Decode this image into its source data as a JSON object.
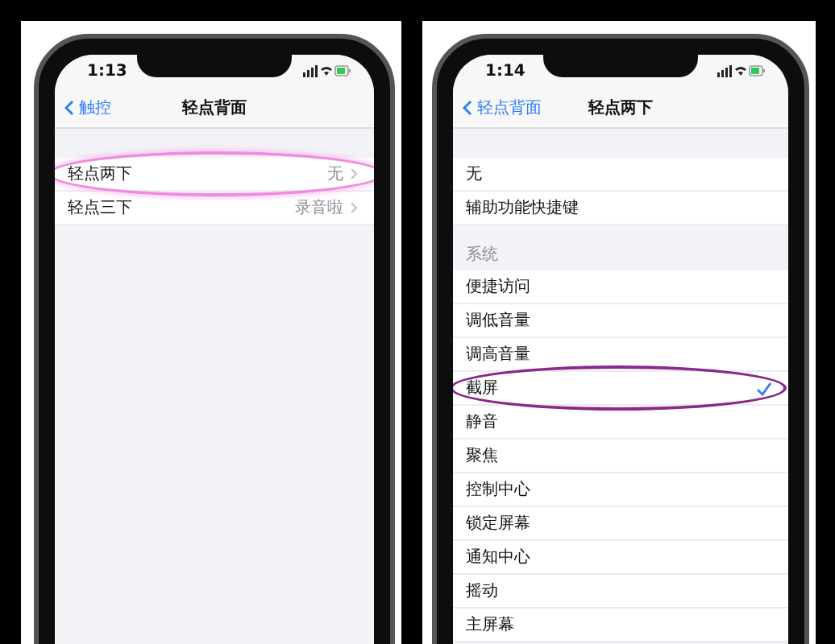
{
  "screens": [
    {
      "status_time": "1:13",
      "back": "触控",
      "title": "轻点背面",
      "sections": [
        {
          "rows": [
            {
              "kind": "link",
              "label": "轻点两下",
              "value": "无",
              "circled": true
            },
            {
              "kind": "link",
              "label": "轻点三下",
              "value": "录音啦",
              "circled": false
            }
          ]
        }
      ]
    },
    {
      "status_time": "1:14",
      "back": "轻点背面",
      "title": "轻点两下",
      "sections": [
        {
          "rows": [
            {
              "kind": "option",
              "label": "无",
              "selected": false,
              "circled": false
            },
            {
              "kind": "option",
              "label": "辅助功能快捷键",
              "selected": false,
              "circled": false
            }
          ]
        },
        {
          "header": "系统",
          "rows": [
            {
              "kind": "option",
              "label": "便捷访问",
              "selected": false,
              "circled": false
            },
            {
              "kind": "option",
              "label": "调低音量",
              "selected": false,
              "circled": false
            },
            {
              "kind": "option",
              "label": "调高音量",
              "selected": false,
              "circled": false
            },
            {
              "kind": "option",
              "label": "截屏",
              "selected": true,
              "circled": true
            },
            {
              "kind": "option",
              "label": "静音",
              "selected": false,
              "circled": false
            },
            {
              "kind": "option",
              "label": "聚焦",
              "selected": false,
              "circled": false
            },
            {
              "kind": "option",
              "label": "控制中心",
              "selected": false,
              "circled": false
            },
            {
              "kind": "option",
              "label": "锁定屏幕",
              "selected": false,
              "circled": false
            },
            {
              "kind": "option",
              "label": "通知中心",
              "selected": false,
              "circled": false
            },
            {
              "kind": "option",
              "label": "摇动",
              "selected": false,
              "circled": false
            },
            {
              "kind": "option",
              "label": "主屏幕",
              "selected": false,
              "circled": false
            }
          ]
        }
      ]
    }
  ]
}
